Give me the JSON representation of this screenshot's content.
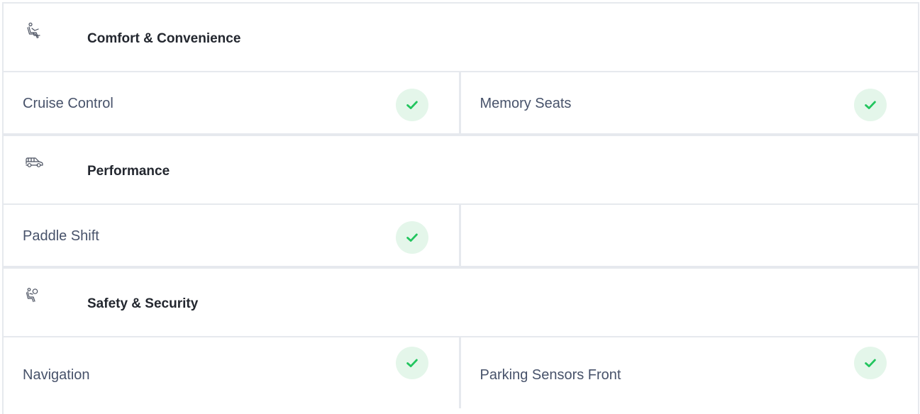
{
  "colors": {
    "check": "#22c55e",
    "check_bg": "#e4f6ea",
    "label": "#47526a",
    "title": "#23272f",
    "border": "#e6e9ee"
  },
  "sections": [
    {
      "title": "Comfort & Convenience",
      "icon": "seat-icon",
      "features": [
        {
          "label": "Cruise Control",
          "checked": true
        },
        {
          "label": "Memory Seats",
          "checked": true
        }
      ]
    },
    {
      "title": "Performance",
      "icon": "car-icon",
      "features": [
        {
          "label": "Paddle Shift",
          "checked": true
        },
        {
          "label": "",
          "checked": false
        }
      ]
    },
    {
      "title": "Safety & Security",
      "icon": "airbag-icon",
      "features": [
        {
          "label": "Navigation",
          "checked": true
        },
        {
          "label": "Parking Sensors Front",
          "checked": true
        }
      ]
    }
  ]
}
